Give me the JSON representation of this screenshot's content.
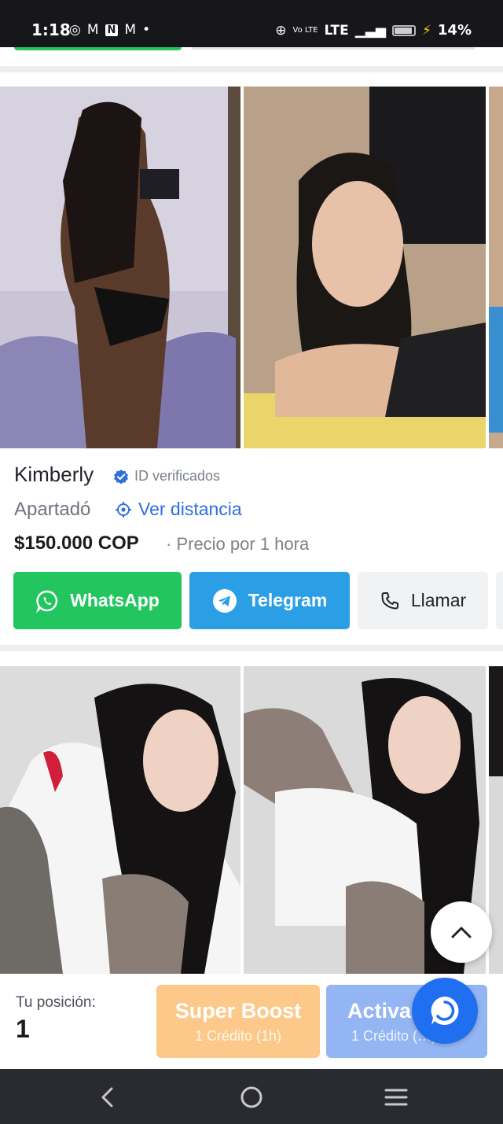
{
  "status_bar": {
    "time": "1:18",
    "network": "LTE",
    "volte": "Vo LTE",
    "battery": "14%"
  },
  "listing": {
    "name": "Kimberly",
    "verified_label": "ID verificados",
    "city": "Apartadó",
    "distance_link": "Ver distancia",
    "price": "$150.000 COP",
    "price_note": "· Precio por 1 hora"
  },
  "actions": {
    "whatsapp": "WhatsApp",
    "telegram": "Telegram",
    "call": "Llamar"
  },
  "bottom": {
    "position_label": "Tu posición:",
    "position_value": "1",
    "super_boost_title": "Super Boost",
    "super_boost_sub": "1 Crédito (1h)",
    "activate_title": "Activa",
    "activate_sub": "1 Crédito (…)"
  },
  "colors": {
    "whatsapp": "#22c55e",
    "telegram": "#2b9fe6",
    "link": "#2f6fde",
    "super_boost": "#fcc98a",
    "activate": "#93b5f3",
    "chat": "#1f6ff0"
  },
  "icons": [
    "whatsapp-icon",
    "telegram-icon",
    "phone-icon",
    "verified-badge-icon",
    "location-target-icon",
    "chevron-up-icon",
    "chat-icon",
    "back-icon",
    "home-icon",
    "menu-icon"
  ]
}
